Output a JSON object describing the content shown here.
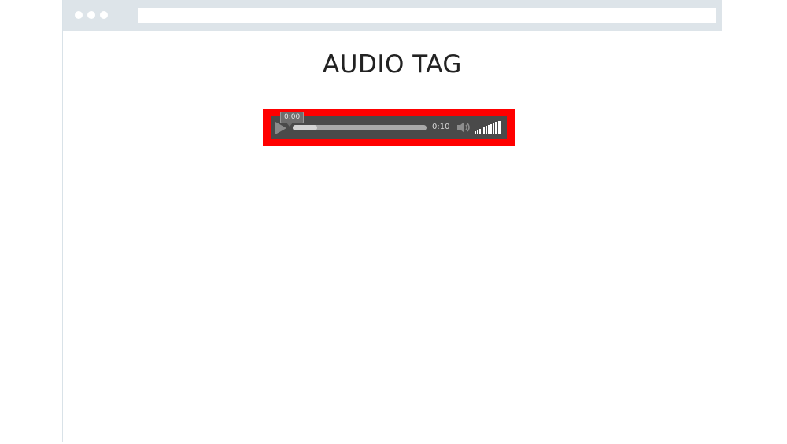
{
  "page": {
    "title": "AUDIO TAG"
  },
  "audio_player": {
    "current_time": "0:00",
    "duration": "0:10",
    "buffered_fraction": 0.18,
    "volume_fraction": 1.0,
    "play_icon": "play-icon",
    "mute_icon": "speaker-icon",
    "volume_icon": "volume-bars-icon",
    "highlight_color": "#ff0000",
    "player_background": "#4a4a4a"
  }
}
